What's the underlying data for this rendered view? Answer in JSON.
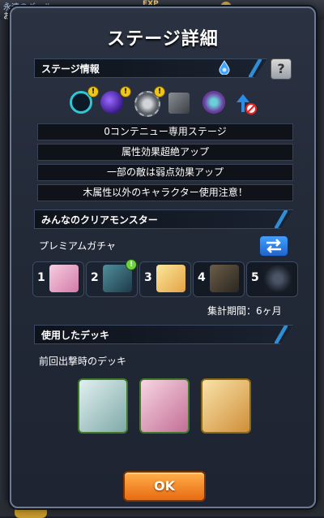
{
  "background": {
    "stage_name": "永遠のギャル",
    "rank_prefix": "お",
    "exp_label": "EXP"
  },
  "dialog": {
    "title": "ステージ詳細",
    "stage_info": {
      "header": "ステージ情報",
      "element_icon": "water-drop-icon",
      "help_label": "?",
      "gimmicks": [
        {
          "icon": "warp-ring-icon",
          "warning": "!"
        },
        {
          "icon": "dark-orb-icon",
          "warning": "!"
        },
        {
          "icon": "gravity-barrier-icon",
          "warning": "!"
        },
        {
          "icon": "block-icon"
        },
        {
          "icon": "minion-icon"
        },
        {
          "icon": "no-speed-up-icon"
        }
      ],
      "notes": [
        "0コンテニュー専用ステージ",
        "属性効果超絶アップ",
        "一部の敵は弱点効果アップ",
        "木属性以外のキャラクター使用注意！"
      ]
    },
    "clear_monsters": {
      "header": "みんなのクリアモンスター",
      "gacha_label": "プレミアムガチャ",
      "swap_icon": "swap-arrows-icon",
      "ranks": [
        {
          "num": "1",
          "color": "#e9a6c4"
        },
        {
          "num": "2",
          "color": "#3b6a7a",
          "badge": "!"
        },
        {
          "num": "3",
          "color": "#f0d46a"
        },
        {
          "num": "4",
          "color": "#6a5c4a"
        },
        {
          "num": "5",
          "color": "#3a4250"
        }
      ],
      "period": "集計期間：6ヶ月"
    },
    "deck": {
      "header": "使用したデッキ",
      "label": "前回出撃時のデッキ",
      "characters": [
        {
          "name": "deck-character-1",
          "color": "#cfe3e6"
        },
        {
          "name": "deck-character-2",
          "color": "#f1c1d1"
        },
        {
          "name": "deck-character-3",
          "color": "#f3d48b"
        }
      ]
    },
    "ok_label": "OK"
  }
}
